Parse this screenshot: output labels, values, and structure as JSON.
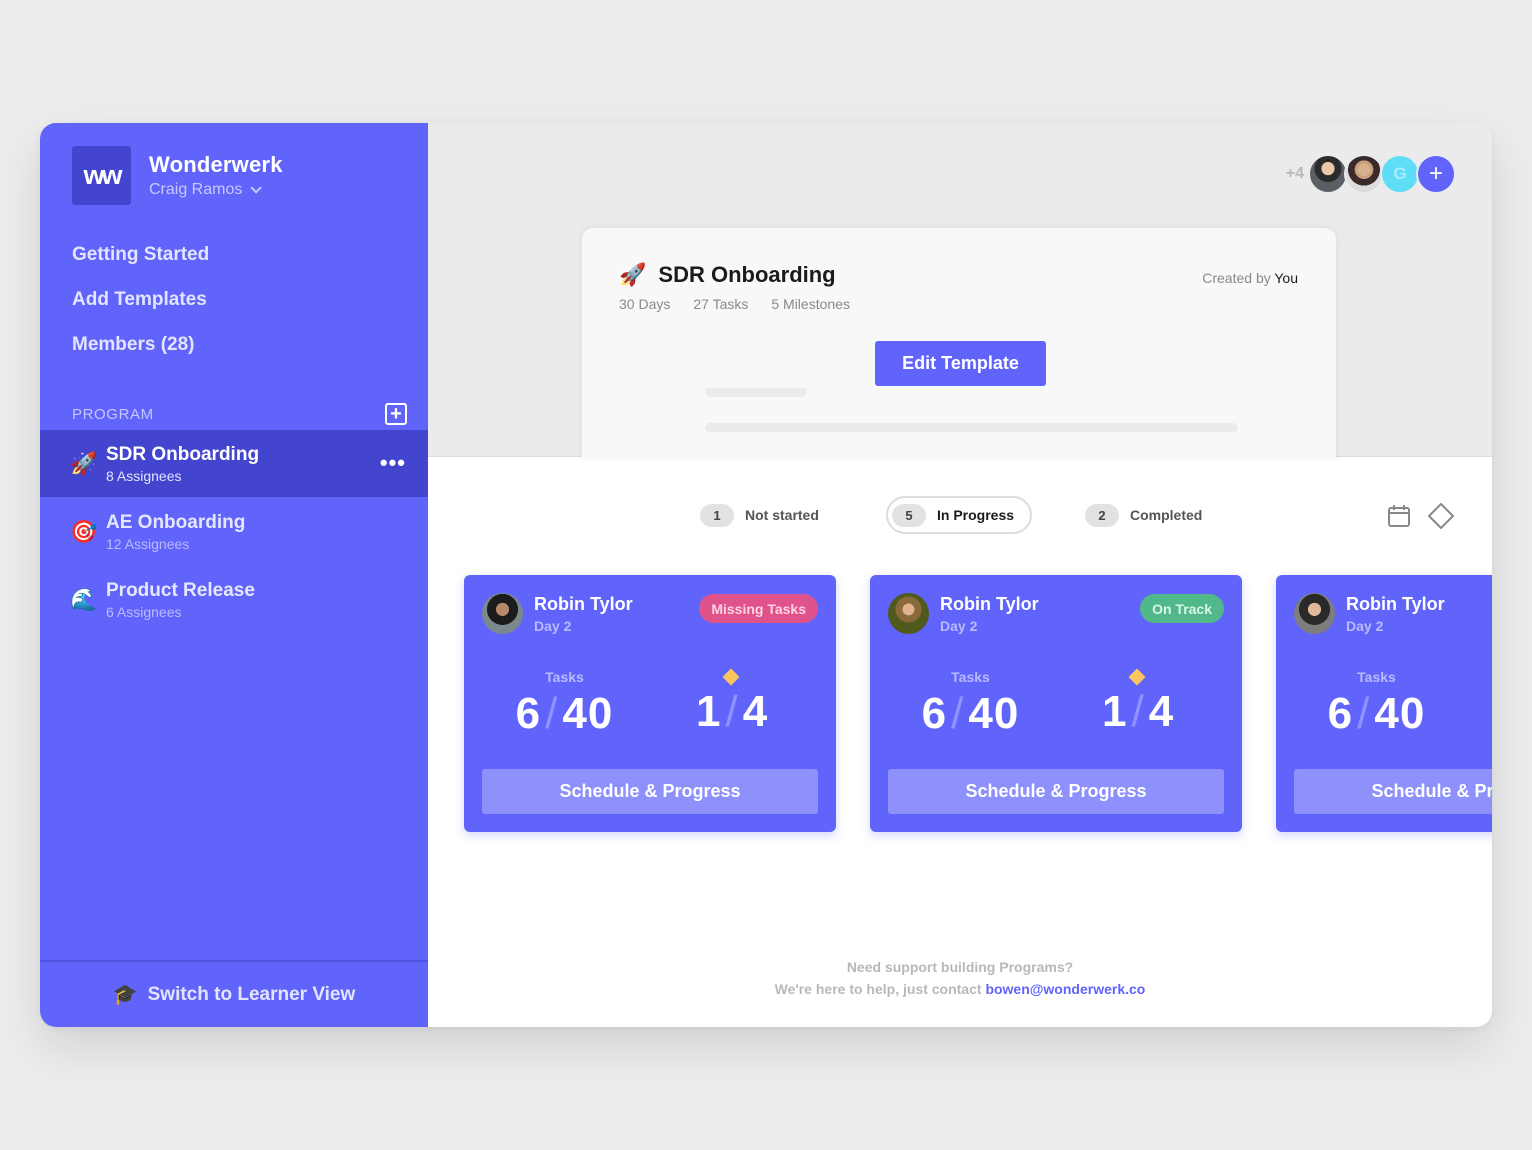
{
  "sidebar": {
    "logo_text": "ww",
    "org_name": "Wonderwerk",
    "user_name": "Craig Ramos",
    "nav": [
      {
        "label": "Getting Started"
      },
      {
        "label": "Add Templates"
      },
      {
        "label": "Members (28)"
      }
    ],
    "section_label": "PROGRAM",
    "programs": [
      {
        "icon": "🚀",
        "icon_name": "rocket-icon",
        "name": "SDR Onboarding",
        "assignees": "8 Assignees",
        "active": true
      },
      {
        "icon": "🎯",
        "icon_name": "target-icon",
        "name": "AE Onboarding",
        "assignees": "12 Assignees",
        "active": false
      },
      {
        "icon": "🌊",
        "icon_name": "wave-icon",
        "name": "Product Release",
        "assignees": "6 Assignees",
        "active": false
      }
    ],
    "more_label": "•••",
    "footer": {
      "icon": "🎓",
      "label": "Switch to Learner View"
    }
  },
  "header": {
    "extra_members": "+4",
    "avatar_initial": "G",
    "add_label": "+"
  },
  "template": {
    "icon": "🚀",
    "title": "SDR Onboarding",
    "meta": [
      "30 Days",
      "27 Tasks",
      "5 Milestones"
    ],
    "created_prefix": "Created by",
    "created_by": "You",
    "edit_label": "Edit Template"
  },
  "filters": [
    {
      "count": "1",
      "label": "Not started"
    },
    {
      "count": "5",
      "label": "In Progress",
      "selected": true
    },
    {
      "count": "2",
      "label": "Completed"
    }
  ],
  "cards": [
    {
      "name": "Robin Tylor",
      "day": "Day 2",
      "status": "Missing Tasks",
      "status_color": "#e0538a",
      "tasks_label": "Tasks",
      "tasks_done": "6",
      "tasks_total": "40",
      "milestones_done": "1",
      "milestones_total": "4",
      "button": "Schedule & Progress"
    },
    {
      "name": "Robin Tylor",
      "day": "Day 2",
      "status": "On Track",
      "status_color": "#51b88a",
      "tasks_label": "Tasks",
      "tasks_done": "6",
      "tasks_total": "40",
      "milestones_done": "1",
      "milestones_total": "4",
      "button": "Schedule & Progress"
    },
    {
      "name": "Robin Tylor",
      "day": "Day 2",
      "tasks_label": "Tasks",
      "tasks_done": "6",
      "tasks_total": "40",
      "button": "Schedule & Progress"
    }
  ],
  "support": {
    "line1": "Need support building Programs?",
    "line2": "We're here to help, just contact",
    "email": "bowen@wonderwerk.co"
  },
  "colors": {
    "accent": "#6164fb",
    "accent_dark": "#4345cf",
    "missing": "#e0538a",
    "on_track": "#51b88a",
    "milestone": "#fcc65e"
  }
}
